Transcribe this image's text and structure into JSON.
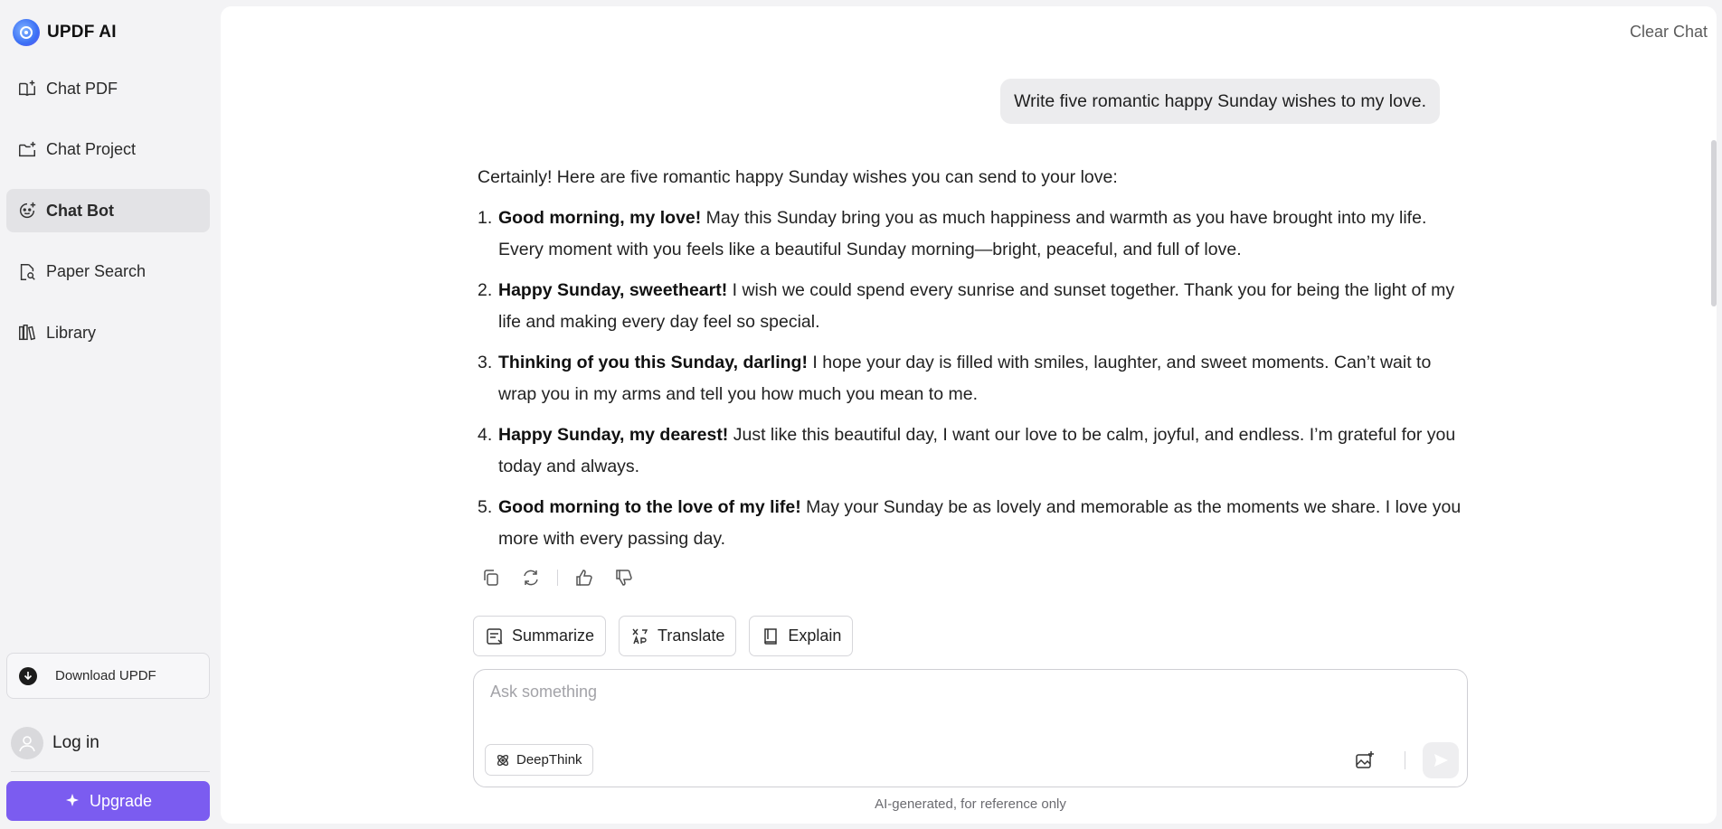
{
  "sidebar": {
    "brand": "UPDF AI",
    "items": [
      {
        "label": "Chat PDF",
        "icon": "book-open-plus-icon",
        "active": false
      },
      {
        "label": "Chat Project",
        "icon": "folder-plus-icon",
        "active": false
      },
      {
        "label": "Chat Bot",
        "icon": "bot-icon",
        "active": true
      },
      {
        "label": "Paper Search",
        "icon": "doc-search-icon",
        "active": false
      },
      {
        "label": "Library",
        "icon": "library-icon",
        "active": false
      }
    ],
    "download_label": "Download UPDF",
    "login_label": "Log in",
    "upgrade_label": "Upgrade"
  },
  "header": {
    "clear_chat": "Clear Chat"
  },
  "conversation": {
    "user_message": "Write five romantic happy Sunday wishes to my love.",
    "answer_intro": "Certainly! Here are five romantic happy Sunday wishes you can send to your love:",
    "wishes": [
      {
        "num": "1.",
        "bold": "Good morning, my love!",
        "text": " May this Sunday bring you as much happiness and warmth as you have brought into my life. Every moment with you feels like a beautiful Sunday morning—bright, peaceful, and full of love."
      },
      {
        "num": "2.",
        "bold": "Happy Sunday, sweetheart!",
        "text": " I wish we could spend every sunrise and sunset together. Thank you for being the light of my life and making every day feel so special."
      },
      {
        "num": "3.",
        "bold": "Thinking of you this Sunday, darling!",
        "text": " I hope your day is filled with smiles, laughter, and sweet moments. Can’t wait to wrap you in my arms and tell you how much you mean to me."
      },
      {
        "num": "4.",
        "bold": "Happy Sunday, my dearest!",
        "text": " Just like this beautiful day, I want our love to be calm, joyful, and endless. I’m grateful for you today and always."
      },
      {
        "num": "5.",
        "bold": "Good morning to the love of my life!",
        "text": " May your Sunday be as lovely and memorable as the moments we share. I love you more with every passing day."
      }
    ]
  },
  "quick_actions": {
    "summarize": "Summarize",
    "translate": "Translate",
    "explain": "Explain"
  },
  "composer": {
    "placeholder": "Ask something",
    "deepthink": "DeepThink"
  },
  "footer": {
    "disclaimer": "AI-generated, for reference only"
  },
  "colors": {
    "accent": "#7b5cf0",
    "active_nav": "#e3e3e6",
    "sidebar_bg": "#f3f3f5"
  }
}
